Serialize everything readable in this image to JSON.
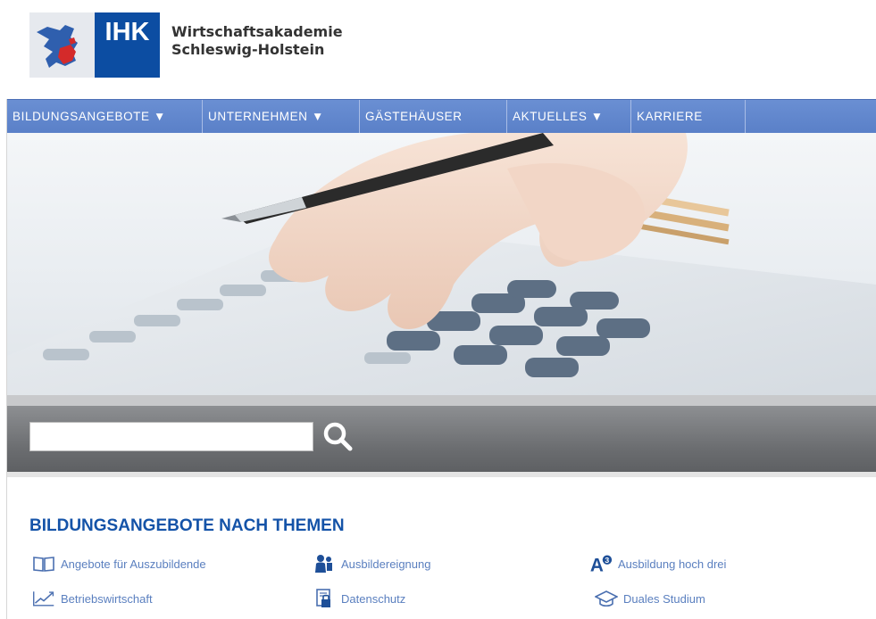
{
  "header": {
    "logo_abbrev": "IHK",
    "org_line1": "Wirtschaftsakademie",
    "org_line2": "Schleswig-Holstein"
  },
  "nav": {
    "items": [
      {
        "label": "BILDUNGSANGEBOTE ▼"
      },
      {
        "label": "UNTERNEHMEN ▼"
      },
      {
        "label": "GÄSTEHÄUSER"
      },
      {
        "label": "AKTUELLES ▼"
      },
      {
        "label": "KARRIERE"
      }
    ]
  },
  "search": {
    "value": "",
    "placeholder": "",
    "icon": "search-icon"
  },
  "themes": {
    "title": "BILDUNGSANGEBOTE NACH THEMEN",
    "items": [
      {
        "label": "Angebote für Auszubildende",
        "icon": "open-book-icon"
      },
      {
        "label": "Ausbildereignung",
        "icon": "trainer-icon"
      },
      {
        "label": "Ausbildung hoch drei",
        "icon": "a-cubed-icon"
      },
      {
        "label": "Betriebswirtschaft",
        "icon": "trend-chart-icon"
      },
      {
        "label": "Datenschutz",
        "icon": "locked-document-icon"
      },
      {
        "label": "Duales Studium",
        "icon": "graduation-cap-icon"
      }
    ]
  },
  "colors": {
    "brand_blue": "#0c4da2",
    "nav_blue": "#5f84cc",
    "link_blue": "#5a7fbf",
    "title_blue": "#1453a8"
  }
}
